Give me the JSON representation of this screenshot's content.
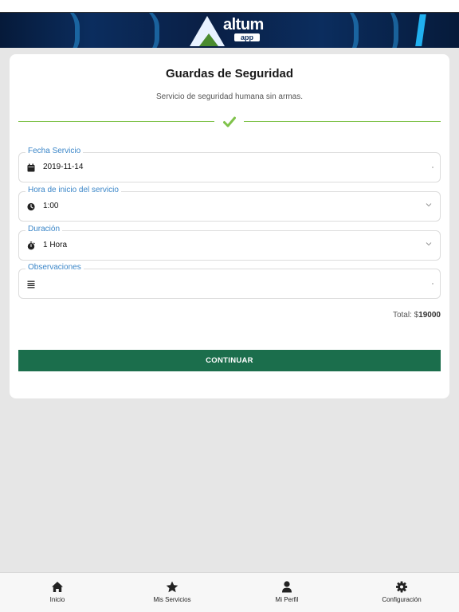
{
  "app": {
    "logo_word": "altum",
    "logo_sub": "app",
    "brand_color": "#0b2d5e",
    "accent_color": "#1b6e4c"
  },
  "service": {
    "title": "Guardas de Seguridad",
    "description": "Servicio de seguridad humana sin armas.",
    "check_icon": "check-icon"
  },
  "form": {
    "fecha": {
      "label": "Fecha Servicio",
      "value": "2019-11-14",
      "icon": "calendar-icon"
    },
    "hora": {
      "label": "Hora de inicio del servicio",
      "value": "1:00",
      "icon": "clock-icon"
    },
    "duracion": {
      "label": "Duración",
      "value": "1 Hora",
      "icon": "stopwatch-icon"
    },
    "observaciones": {
      "label": "Observaciones",
      "value": "",
      "icon": "list-icon"
    }
  },
  "total": {
    "label": "Total: $",
    "amount": "19000"
  },
  "continue_label": "CONTINUAR",
  "tabs": [
    {
      "label": "Inicio",
      "icon": "home-icon"
    },
    {
      "label": "Mis Servicios",
      "icon": "star-icon"
    },
    {
      "label": "Mi Perfil",
      "icon": "user-icon"
    },
    {
      "label": "Configuración",
      "icon": "gear-icon"
    }
  ]
}
